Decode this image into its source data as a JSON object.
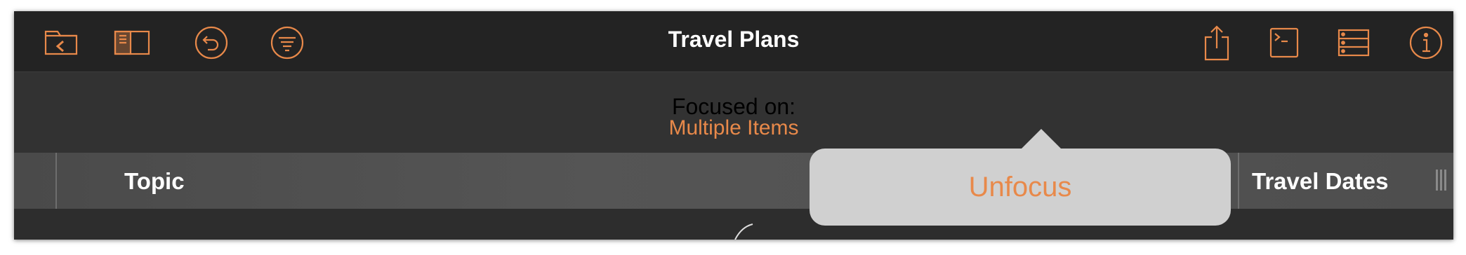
{
  "toolbar": {
    "title": "Travel Plans",
    "left_icons": [
      "documents-folder-icon",
      "sidebar-icon",
      "undo-icon",
      "filter-icon"
    ],
    "right_icons": [
      "share-icon",
      "console-icon",
      "outline-columns-icon",
      "info-icon"
    ]
  },
  "focus": {
    "label": "Focused on:",
    "value": "Multiple Items"
  },
  "columns": {
    "topic": "Topic",
    "travel_dates": "Travel Dates"
  },
  "popover": {
    "unfocus_label": "Unfocus"
  },
  "colors": {
    "accent": "#e8894a",
    "toolbar_bg": "#232323",
    "popover_bg": "#d0d0d0"
  }
}
